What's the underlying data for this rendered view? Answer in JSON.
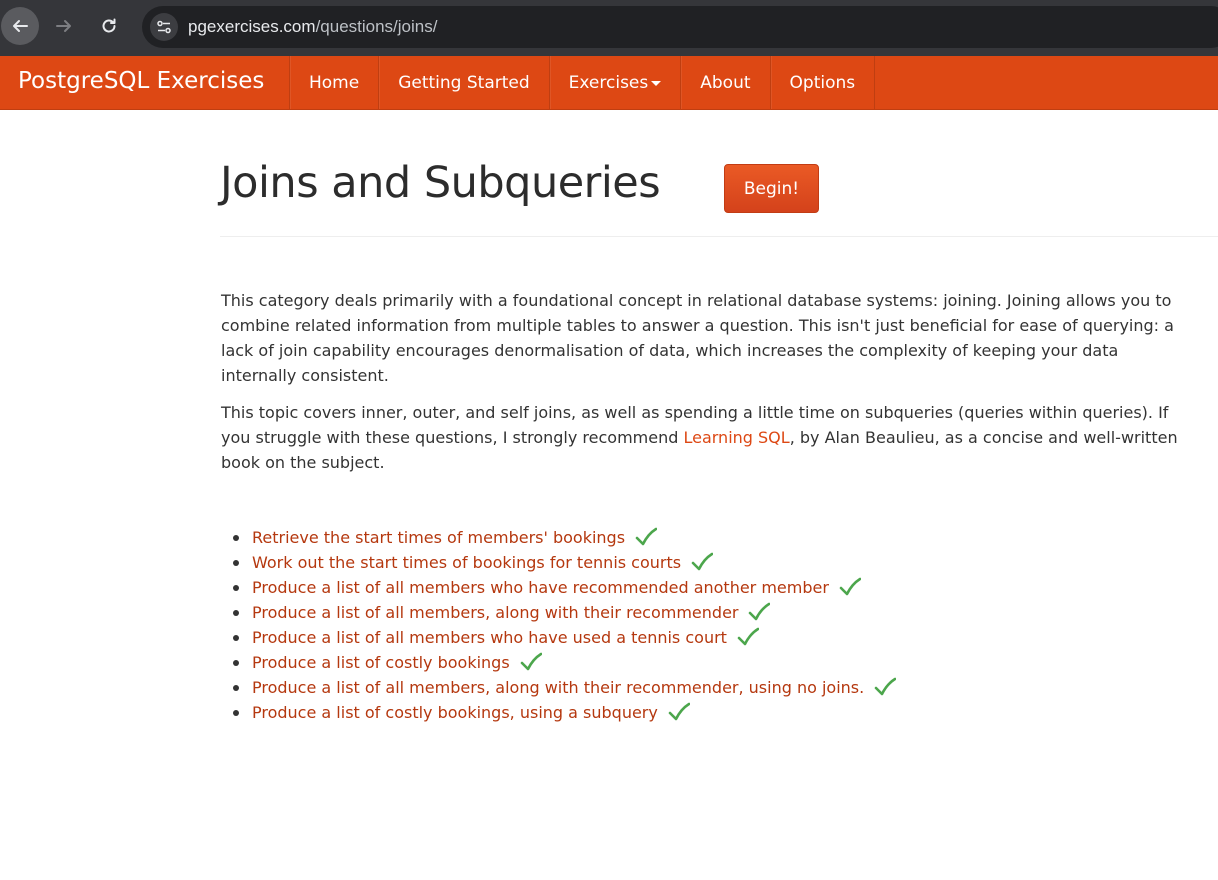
{
  "browser": {
    "url_host": "pgexercises.com",
    "url_path": "/questions/joins/"
  },
  "site": {
    "brand": "PostgreSQL Exercises",
    "nav": [
      {
        "label": "Home"
      },
      {
        "label": "Getting Started"
      },
      {
        "label": "Exercises",
        "has_dropdown": true
      },
      {
        "label": "About"
      },
      {
        "label": "Options"
      }
    ],
    "accent_color": "#dd4814"
  },
  "page": {
    "title": "Joins and Subqueries",
    "begin_label": "Begin!",
    "para1": "This category deals primarily with a foundational concept in relational database systems: joining. Joining allows you to combine related information from multiple tables to answer a question. This isn't just beneficial for ease of querying: a lack of join capability encourages denormalisation of data, which increases the complexity of keeping your data internally consistent.",
    "para2_before": "This topic covers inner, outer, and self joins, as well as spending a little time on subqueries (queries within queries). If you struggle with these questions, I strongly recommend ",
    "para2_link": "Learning SQL",
    "para2_after": ", by Alan Beaulieu, as a concise and well-written book on the subject.",
    "exercises": [
      {
        "label": "Retrieve the start times of members' bookings",
        "completed": true
      },
      {
        "label": "Work out the start times of bookings for tennis courts",
        "completed": true
      },
      {
        "label": "Produce a list of all members who have recommended another member",
        "completed": true
      },
      {
        "label": "Produce a list of all members, along with their recommender",
        "completed": true
      },
      {
        "label": "Produce a list of all members who have used a tennis court",
        "completed": true
      },
      {
        "label": "Produce a list of costly bookings",
        "completed": true
      },
      {
        "label": "Produce a list of all members, along with their recommender, using no joins.",
        "completed": true
      },
      {
        "label": "Produce a list of costly bookings, using a subquery",
        "completed": true
      }
    ]
  }
}
